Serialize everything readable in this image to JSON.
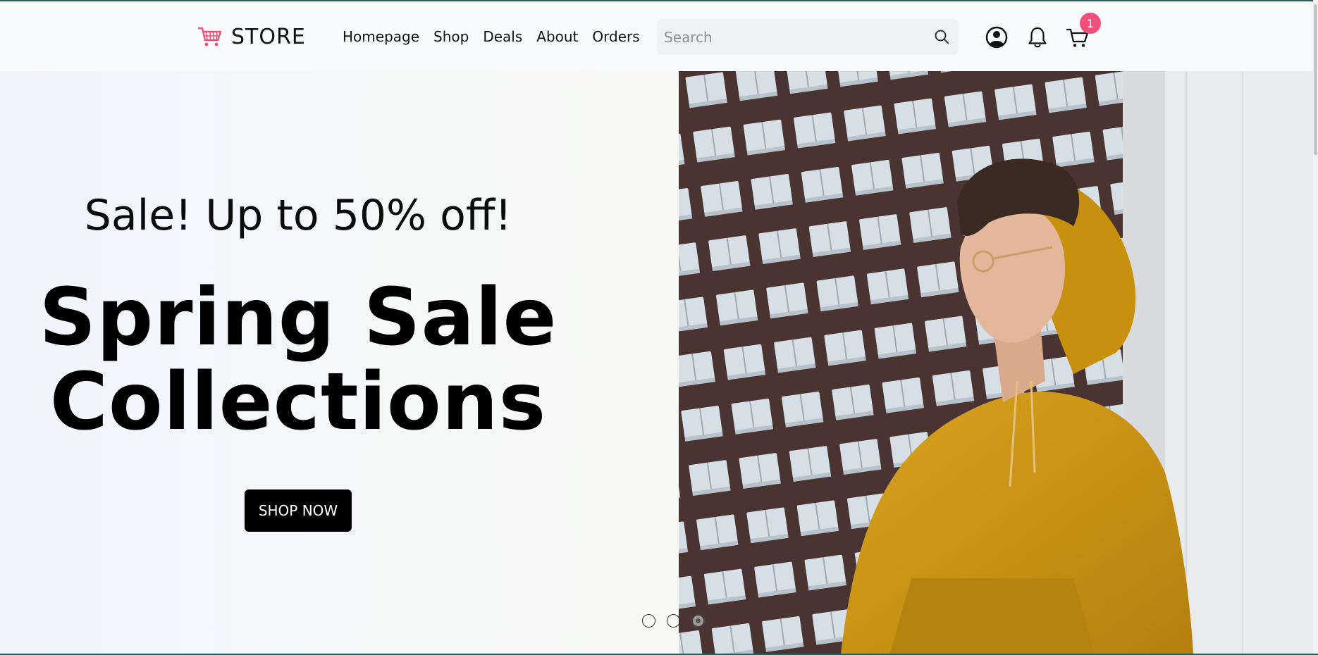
{
  "brand": {
    "name": "STORE",
    "icon": "cart-icon",
    "icon_color": "#f0517a"
  },
  "nav": {
    "items": [
      {
        "label": "Homepage"
      },
      {
        "label": "Shop"
      },
      {
        "label": "Deals"
      },
      {
        "label": "About"
      },
      {
        "label": "Orders"
      }
    ]
  },
  "search": {
    "placeholder": "Search",
    "value": "",
    "icon": "search-icon"
  },
  "header_icons": {
    "user": "user-circle-icon",
    "notifications": "bell-icon",
    "cart": "shopping-cart-icon",
    "cart_count": "1",
    "badge_color": "#f0517a"
  },
  "hero": {
    "subtitle": "Sale! Up to 50% off!",
    "title_line1": "Spring Sale",
    "title_line2": "Collections",
    "cta_label": "SHOP NOW",
    "image": "man-in-yellow-hoodie-photo"
  },
  "carousel": {
    "total": 3,
    "active_index": 3
  }
}
